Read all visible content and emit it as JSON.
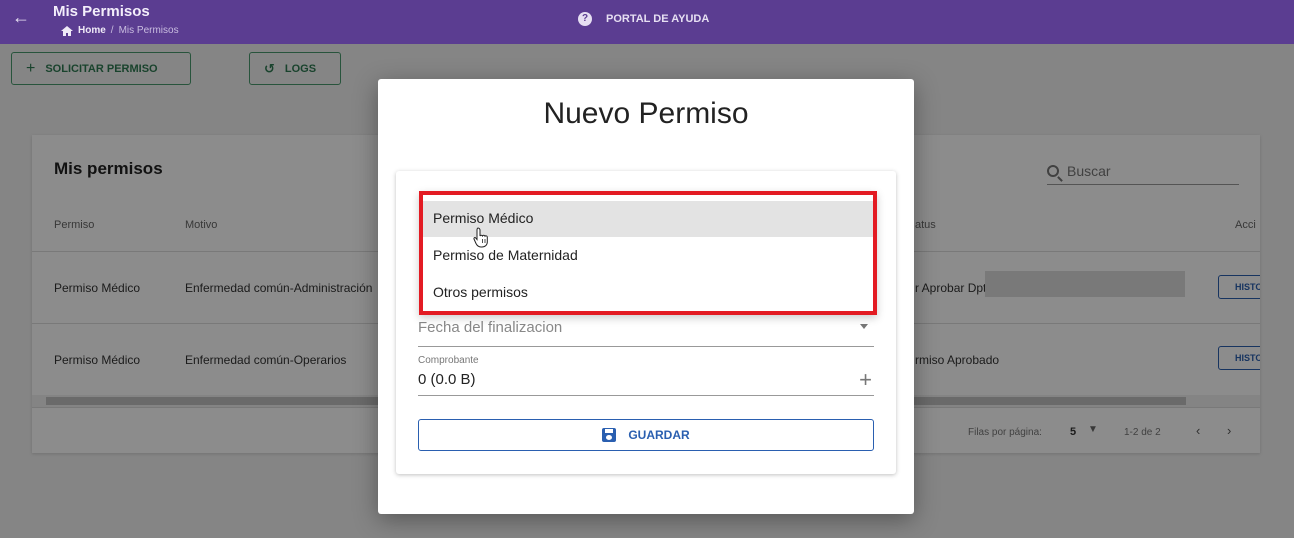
{
  "header": {
    "title": "Mis Permisos",
    "breadcrumb": [
      "Home",
      "/",
      "Mis Permisos"
    ],
    "help": "PORTAL DE AYUDA"
  },
  "toolbar": {
    "solicitar_label": "SOLICITAR PERMISO",
    "logs_label": "LOGS"
  },
  "table": {
    "title": "Mis permisos",
    "search_placeholder": "Buscar",
    "columns": [
      "Permiso",
      "Motivo",
      "atus",
      "Acci"
    ],
    "rows": [
      {
        "permiso": "Permiso Médico",
        "motivo": "Enfermedad común-Administración",
        "status": "r Aprobar Dpt",
        "action": "HISTO"
      },
      {
        "permiso": "Permiso Médico",
        "motivo": "Enfermedad común-Operarios",
        "status": "rmiso Aprobado",
        "action": "HISTO"
      }
    ],
    "footer": {
      "rows_per_page_label": "Filas por página:",
      "rows_per_page": "5",
      "range": "1-2 de 2"
    }
  },
  "dialog": {
    "title": "Nuevo Permiso",
    "dropdown_options": [
      "Permiso Médico",
      "Permiso de Maternidad",
      "Otros permisos"
    ],
    "selected_option": "Permiso Médico",
    "fecha_fin_placeholder": "Fecha del finalizacion",
    "comprobante_label": "Comprobante",
    "comprobante_value": "0 (0.0 B)",
    "save_label": "GUARDAR"
  },
  "colors": {
    "header_bg": "#5b3d91",
    "accent_blue": "#2a5fb0",
    "accent_green": "#2f7a52",
    "highlight_red": "#e31b23"
  }
}
